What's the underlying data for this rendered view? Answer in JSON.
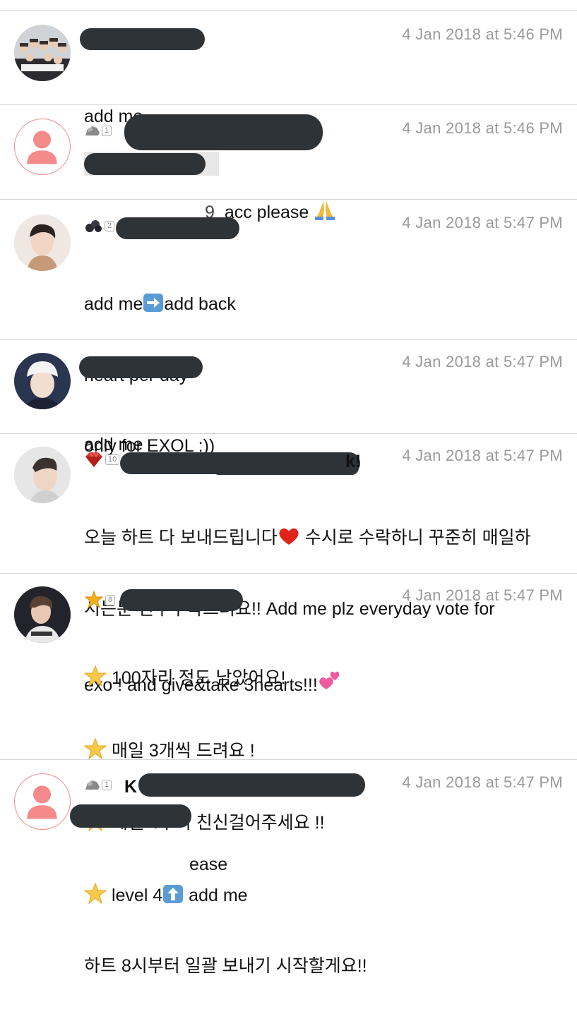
{
  "posts": [
    {
      "timestamp": "4 Jan 2018 at 5:46 PM",
      "lines": [
        "add me"
      ],
      "avatar_icon": "group-photo-avatar"
    },
    {
      "timestamp": "4 Jan 2018 at 5:46 PM",
      "badge_level": "1",
      "badge_icon": "rock-icon",
      "name_tail": "9",
      "text": "acc please",
      "emoji": "folded-hands-icon",
      "avatar_icon": "default-person-avatar"
    },
    {
      "timestamp": "4 Jan 2018 at 5:47 PM",
      "badge_level": "2",
      "badge_icon": "coal-icon",
      "line1_a": "add me",
      "line1_emoji": "right-arrow-icon",
      "line1_b": "add back",
      "lines": [
        "heart per day",
        "only for EXOL :))"
      ],
      "avatar_icon": "user-photo-avatar"
    },
    {
      "timestamp": "4 Jan 2018 at 5:47 PM",
      "lines": [
        "add me"
      ],
      "avatar_icon": "user-photo-avatar"
    },
    {
      "timestamp": "4 Jan 2018 at 5:47 PM",
      "badge_level": "10",
      "badge_icon": "ruby-icon",
      "name_tail": "k!",
      "line1_a": "오늘 하트 다 보내드립니다",
      "line1_emoji": "red-heart-icon",
      "line1_b": " 수시로 수락하니 꾸준히 매일하",
      "line2": "시는분 친추부탁드려요!! Add me plz everyday vote for",
      "line3": "exo ! and give&take 3hearts!!!",
      "line3_emoji": "two-hearts-icon",
      "avatar_icon": "user-photo-avatar"
    },
    {
      "timestamp": "4 Jan 2018 at 5:47 PM",
      "badge_level": "8",
      "badge_icon": "gold-star-icon",
      "star_lines": [
        "100자리 정도 남았어요!",
        "매일 3개씩 드려요 !",
        "레벨 4부터 친신걸어주세요 !!"
      ],
      "level_line_a": "level 4",
      "level_line_emoji": "up-arrow-icon",
      "level_line_b": " add me",
      "last_line": "하트 8시부터 일괄 보내기 시작할게요!!",
      "avatar_icon": "user-photo-avatar"
    },
    {
      "timestamp": "4 Jan 2018 at 5:47 PM",
      "badge_level": "1",
      "badge_icon": "rock-icon",
      "name_head": "K",
      "text_tail": "ease",
      "avatar_icon": "default-person-avatar"
    }
  ]
}
